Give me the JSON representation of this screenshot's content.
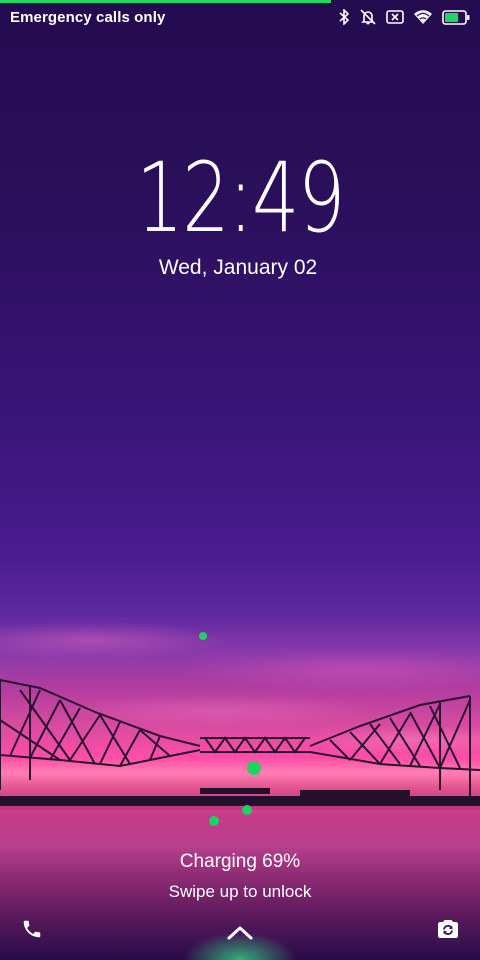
{
  "status_bar": {
    "carrier_text": "Emergency calls only",
    "icons": [
      "bluetooth-icon",
      "alarm-off-icon",
      "no-sim-icon",
      "wifi-icon",
      "battery-icon"
    ],
    "battery_level": 0.69,
    "accent_color": "#1ed760"
  },
  "lockscreen": {
    "time": "12:49",
    "date": "Wed, January 02",
    "charging_text": "Charging 69%",
    "unlock_hint": "Swipe up to unlock"
  },
  "shortcuts": {
    "left": "phone-icon",
    "center": "chevron-up-icon",
    "right": "camera-icon"
  },
  "colors": {
    "sky_top": "#240b4f",
    "horizon": "#ff4ea7",
    "charge_dots": "#1fd160"
  }
}
